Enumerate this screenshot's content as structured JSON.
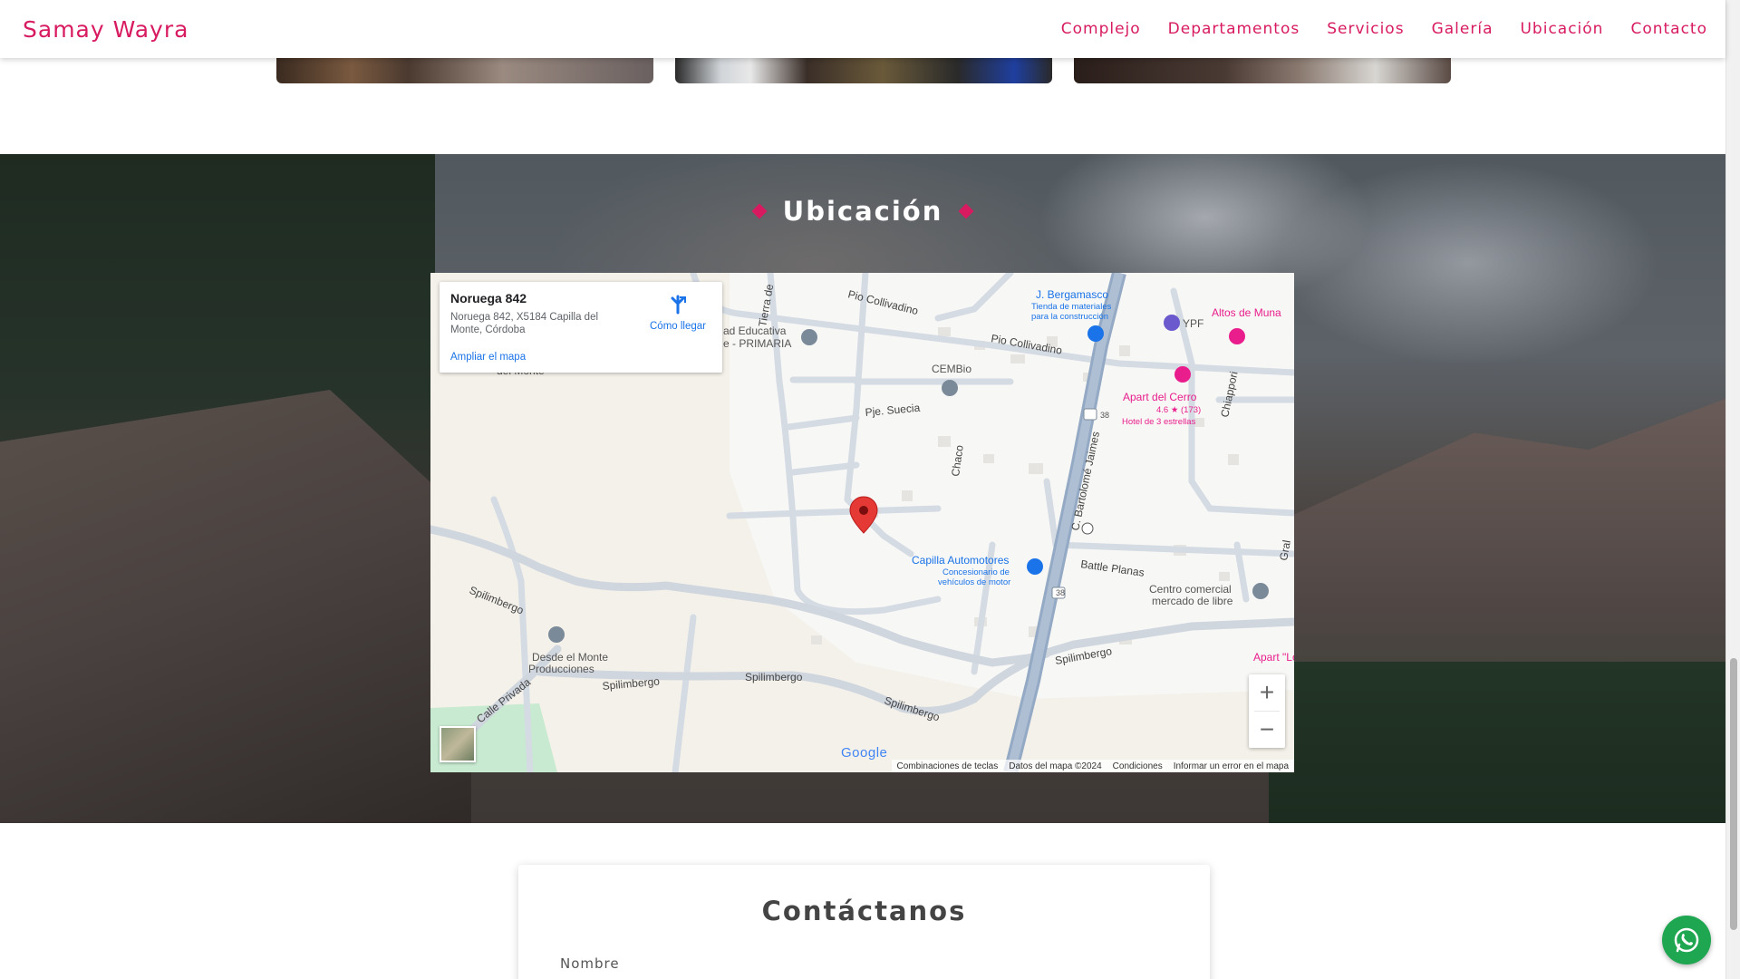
{
  "nav": {
    "brand": "Samay Wayra",
    "links": [
      "Complejo",
      "Departamentos",
      "Servicios",
      "Galería",
      "Ubicación",
      "Contacto"
    ]
  },
  "location": {
    "title": "Ubicación",
    "map": {
      "place_name": "Noruega 842",
      "address": "Noruega 842, X5184 Capilla del Monte, Córdoba",
      "directions_label": "Cómo llegar",
      "enlarge_label": "Ampliar el mapa",
      "zoom_in": "+",
      "zoom_out": "−",
      "logo": "Google",
      "attribution": [
        "Combinaciones de teclas",
        "Datos del mapa ©2024",
        "Condiciones",
        "Informar un error en el mapa"
      ],
      "labels": {
        "school": "ad Educativa",
        "school_2": "e - PRIMARIA",
        "school_3": "del Monte",
        "pio1": "Pio Collivadino",
        "pio2": "Pio Collivadino",
        "tierra": "Tierra de",
        "bergamasco": "J. Bergamasco",
        "bergamasco_sub1": "Tienda de materiales",
        "bergamasco_sub2": "para la construcción",
        "ypf": "YPF",
        "altos": "Altos de Muna",
        "cembio": "CEMBio",
        "suecia": "Pje. Suecia",
        "chaco": "Chaco",
        "jaimes": "C. Bartolomé Jaimes",
        "chiappori": "Chiappori",
        "apart_cerro": "Apart del Cerro",
        "apart_rating": "4.6 ★ (173)",
        "apart_type": "Hotel de 3 estrellas",
        "route_38": "38",
        "capilla": "Capilla Automotores",
        "capilla_sub1": "Concesionario de",
        "capilla_sub2": "vehículos de motor",
        "battle": "Battle Planas",
        "centro1": "Centro comercial",
        "centro2": "mercado de libre",
        "spil1": "Spilimbergo",
        "spil2": "Spilimbergo",
        "spil3": "Spilimbergo",
        "spil4": "Spilimbergo",
        "spil5": "Spilimbergo",
        "desde1": "Desde el Monte",
        "desde2": "Producciones",
        "calle_privada": "Calle Privada",
        "apart_lo": "Apart \"Lo",
        "gral": "Gral"
      }
    }
  },
  "contact": {
    "title": "Contáctanos",
    "name_label": "Nombre"
  },
  "colors": {
    "accent": "#d81b60",
    "whatsapp": "#1ea651",
    "map_link": "#1a73e8",
    "marker": "#e53935"
  },
  "icons": {
    "directions": "directions-icon",
    "whatsapp": "whatsapp-icon",
    "marker": "location-pin-icon"
  }
}
